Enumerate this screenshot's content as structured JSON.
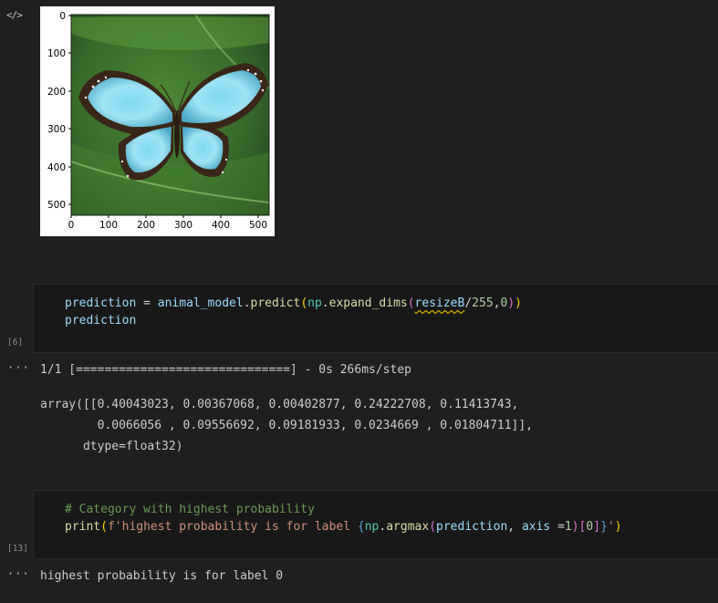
{
  "gutter": {
    "icon": "</>"
  },
  "image_output": {
    "y_ticks": [
      "0",
      "100",
      "200",
      "300",
      "400",
      "500"
    ],
    "x_ticks": [
      "0",
      "100",
      "200",
      "300",
      "400",
      "500"
    ]
  },
  "cell6": {
    "exec_count": "[6]",
    "line1": {
      "var": "prediction",
      "eq": " = ",
      "obj": "animal_model",
      "dot1": ".",
      "fn": "predict",
      "p_open": "(",
      "mod": "np",
      "dot2": ".",
      "fn2": "expand_dims",
      "p2_open": "(",
      "arg": "resizeB",
      "div": "/",
      "num1": "255",
      "comma": ",",
      "num2": "0",
      "p2_close": ")",
      "p_close": ")"
    },
    "line2": "prediction",
    "output": {
      "dots": "···",
      "progress": "1/1 [==============================] - 0s 266ms/step",
      "array_line1": "array([[0.40043023, 0.00367068, 0.00402877, 0.24222708, 0.11413743,",
      "array_line2": "        0.0066056 , 0.09556692, 0.09181933, 0.0234669 , 0.01804711]],",
      "array_line3": "      dtype=float32)"
    }
  },
  "cell13": {
    "exec_count": "[13]",
    "comment": "# Category with highest probability",
    "print_fn": "print",
    "p_open": "(",
    "str_start": "f'highest probability is for label ",
    "brace_open": "{",
    "mod": "np",
    "dot": ".",
    "fn": "argmax",
    "p2_open": "(",
    "arg": "prediction",
    "comma": ", ",
    "kw": "axis",
    "eq": " =",
    "num": "1",
    "p2_close": ")",
    "idx_open": "[",
    "idx": "0",
    "idx_close": "]",
    "brace_close": "}",
    "str_end": "'",
    "p_close": ")",
    "output": {
      "dots": "···",
      "text": "highest probability is for label 0"
    }
  }
}
